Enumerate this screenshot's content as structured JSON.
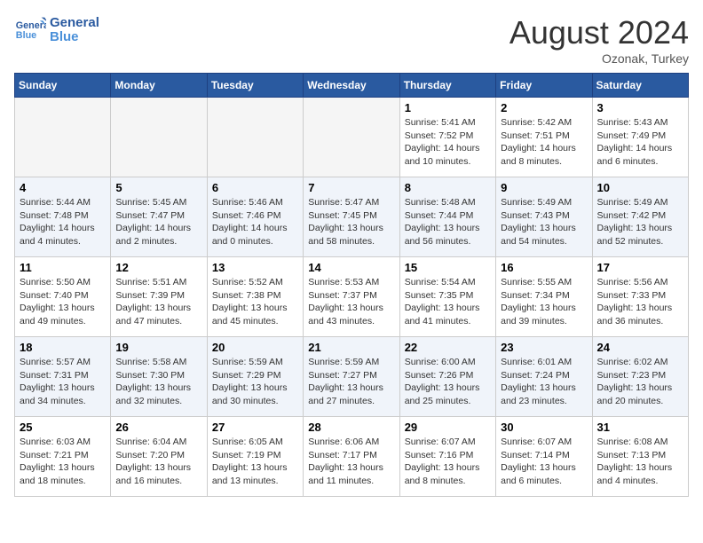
{
  "header": {
    "logo_line1": "General",
    "logo_line2": "Blue",
    "month_year": "August 2024",
    "location": "Ozonak, Turkey"
  },
  "days_of_week": [
    "Sunday",
    "Monday",
    "Tuesday",
    "Wednesday",
    "Thursday",
    "Friday",
    "Saturday"
  ],
  "weeks": [
    {
      "days": [
        {
          "num": "",
          "empty": true
        },
        {
          "num": "",
          "empty": true
        },
        {
          "num": "",
          "empty": true
        },
        {
          "num": "",
          "empty": true
        },
        {
          "num": "1",
          "sunrise": "5:41 AM",
          "sunset": "7:52 PM",
          "daylight": "14 hours and 10 minutes."
        },
        {
          "num": "2",
          "sunrise": "5:42 AM",
          "sunset": "7:51 PM",
          "daylight": "14 hours and 8 minutes."
        },
        {
          "num": "3",
          "sunrise": "5:43 AM",
          "sunset": "7:49 PM",
          "daylight": "14 hours and 6 minutes."
        }
      ]
    },
    {
      "days": [
        {
          "num": "4",
          "sunrise": "5:44 AM",
          "sunset": "7:48 PM",
          "daylight": "14 hours and 4 minutes."
        },
        {
          "num": "5",
          "sunrise": "5:45 AM",
          "sunset": "7:47 PM",
          "daylight": "14 hours and 2 minutes."
        },
        {
          "num": "6",
          "sunrise": "5:46 AM",
          "sunset": "7:46 PM",
          "daylight": "14 hours and 0 minutes."
        },
        {
          "num": "7",
          "sunrise": "5:47 AM",
          "sunset": "7:45 PM",
          "daylight": "13 hours and 58 minutes."
        },
        {
          "num": "8",
          "sunrise": "5:48 AM",
          "sunset": "7:44 PM",
          "daylight": "13 hours and 56 minutes."
        },
        {
          "num": "9",
          "sunrise": "5:49 AM",
          "sunset": "7:43 PM",
          "daylight": "13 hours and 54 minutes."
        },
        {
          "num": "10",
          "sunrise": "5:49 AM",
          "sunset": "7:42 PM",
          "daylight": "13 hours and 52 minutes."
        }
      ]
    },
    {
      "days": [
        {
          "num": "11",
          "sunrise": "5:50 AM",
          "sunset": "7:40 PM",
          "daylight": "13 hours and 49 minutes."
        },
        {
          "num": "12",
          "sunrise": "5:51 AM",
          "sunset": "7:39 PM",
          "daylight": "13 hours and 47 minutes."
        },
        {
          "num": "13",
          "sunrise": "5:52 AM",
          "sunset": "7:38 PM",
          "daylight": "13 hours and 45 minutes."
        },
        {
          "num": "14",
          "sunrise": "5:53 AM",
          "sunset": "7:37 PM",
          "daylight": "13 hours and 43 minutes."
        },
        {
          "num": "15",
          "sunrise": "5:54 AM",
          "sunset": "7:35 PM",
          "daylight": "13 hours and 41 minutes."
        },
        {
          "num": "16",
          "sunrise": "5:55 AM",
          "sunset": "7:34 PM",
          "daylight": "13 hours and 39 minutes."
        },
        {
          "num": "17",
          "sunrise": "5:56 AM",
          "sunset": "7:33 PM",
          "daylight": "13 hours and 36 minutes."
        }
      ]
    },
    {
      "days": [
        {
          "num": "18",
          "sunrise": "5:57 AM",
          "sunset": "7:31 PM",
          "daylight": "13 hours and 34 minutes."
        },
        {
          "num": "19",
          "sunrise": "5:58 AM",
          "sunset": "7:30 PM",
          "daylight": "13 hours and 32 minutes."
        },
        {
          "num": "20",
          "sunrise": "5:59 AM",
          "sunset": "7:29 PM",
          "daylight": "13 hours and 30 minutes."
        },
        {
          "num": "21",
          "sunrise": "5:59 AM",
          "sunset": "7:27 PM",
          "daylight": "13 hours and 27 minutes."
        },
        {
          "num": "22",
          "sunrise": "6:00 AM",
          "sunset": "7:26 PM",
          "daylight": "13 hours and 25 minutes."
        },
        {
          "num": "23",
          "sunrise": "6:01 AM",
          "sunset": "7:24 PM",
          "daylight": "13 hours and 23 minutes."
        },
        {
          "num": "24",
          "sunrise": "6:02 AM",
          "sunset": "7:23 PM",
          "daylight": "13 hours and 20 minutes."
        }
      ]
    },
    {
      "days": [
        {
          "num": "25",
          "sunrise": "6:03 AM",
          "sunset": "7:21 PM",
          "daylight": "13 hours and 18 minutes."
        },
        {
          "num": "26",
          "sunrise": "6:04 AM",
          "sunset": "7:20 PM",
          "daylight": "13 hours and 16 minutes."
        },
        {
          "num": "27",
          "sunrise": "6:05 AM",
          "sunset": "7:19 PM",
          "daylight": "13 hours and 13 minutes."
        },
        {
          "num": "28",
          "sunrise": "6:06 AM",
          "sunset": "7:17 PM",
          "daylight": "13 hours and 11 minutes."
        },
        {
          "num": "29",
          "sunrise": "6:07 AM",
          "sunset": "7:16 PM",
          "daylight": "13 hours and 8 minutes."
        },
        {
          "num": "30",
          "sunrise": "6:07 AM",
          "sunset": "7:14 PM",
          "daylight": "13 hours and 6 minutes."
        },
        {
          "num": "31",
          "sunrise": "6:08 AM",
          "sunset": "7:13 PM",
          "daylight": "13 hours and 4 minutes."
        }
      ]
    }
  ],
  "labels": {
    "sunrise": "Sunrise:",
    "sunset": "Sunset:",
    "daylight": "Daylight:"
  }
}
